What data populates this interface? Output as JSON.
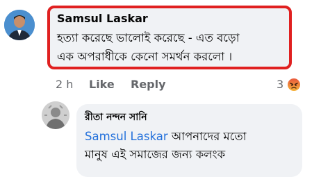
{
  "comment": {
    "author": "Samsul Laskar",
    "text_line1": "হত্যা করেছে ভালোই করেছে - এত বড়ো",
    "text_line2": "এক অপরাধীকে কেনো সমর্থন করলো ।",
    "time": "2 h",
    "like_label": "Like",
    "reply_label": "Reply",
    "reaction_count": "3",
    "reaction_icon": "angry-reaction-icon"
  },
  "reply": {
    "author": "রীতা নন্দন সানি",
    "mention": "Samsul Laskar",
    "text_line1_rest": " আপনাদের মতো",
    "text_line2": "মানুষ এই সমাজের জন্য কলংক"
  },
  "colors": {
    "highlight_border": "#e02020",
    "bubble_bg": "#f0f2f5",
    "mention": "#216fdb",
    "meta_text": "#65676b"
  }
}
